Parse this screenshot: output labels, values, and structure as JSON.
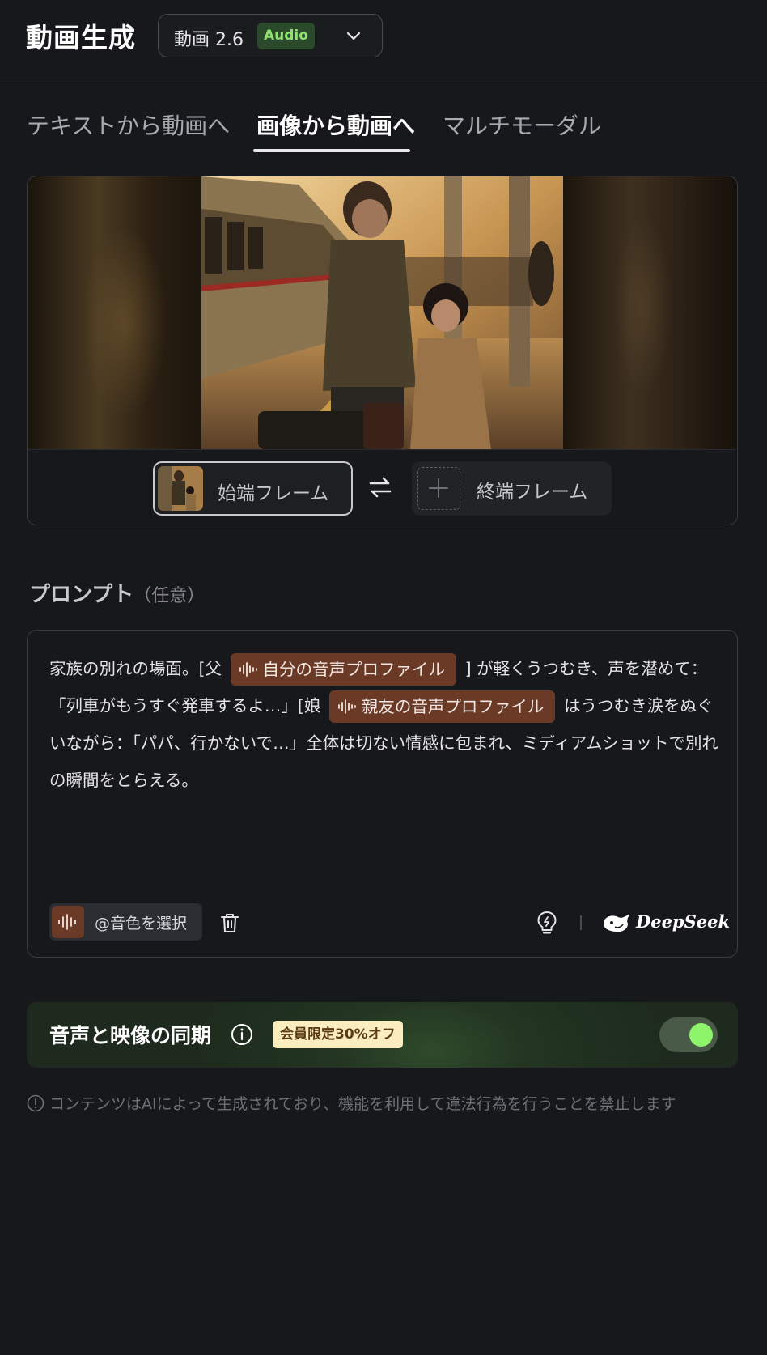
{
  "header": {
    "title": "動画生成",
    "model": {
      "name": "動画 2.6",
      "badge": "Audio"
    }
  },
  "tabs": [
    {
      "label": "テキストから動画へ",
      "active": false
    },
    {
      "label": "画像から動画へ",
      "active": true
    },
    {
      "label": "マルチモーダル",
      "active": false
    }
  ],
  "frames": {
    "start_label": "始端フレーム",
    "end_label": "終端フレーム"
  },
  "prompt": {
    "heading": "プロンプト",
    "optional": "（任意）",
    "text_1": "家族の別れの場面。[父",
    "chip_1": "自分の音声プロファイル",
    "text_2": "] が軽くうつむき、声を潜めて：「列車がもうすぐ発車するよ…」[娘",
    "chip_2": "親友の音声プロファイル",
    "text_3": "はうつむき涙をぬぐいながら：「パパ、行かないで…」全体は切ない情感に包まれ、ミディアムショットで別れの瞬間をとらえる。",
    "select_voice": "@音色を選択",
    "brand": "DeepSeek"
  },
  "sync": {
    "title": "音声と映像の同期",
    "badge": "会員限定30%オフ",
    "enabled": true
  },
  "footer_note": "コンテンツはAIによって生成されており、機能を利用して違法行為を行うことを禁止します",
  "colors": {
    "background": "#17181c",
    "accent_green": "#8ef56a",
    "voice_chip": "#6a3a27",
    "badge_cream": "#fbedbd"
  },
  "icons": {
    "model_dropdown": "chevron-down-icon",
    "swap": "swap-arrows-icon",
    "add_frame": "plus-icon",
    "voice": "sound-wave-icon",
    "delete": "trash-icon",
    "hint": "lightbulb-icon",
    "brand": "deepseek-whale-icon",
    "info": "info-icon",
    "notice": "info-icon"
  }
}
